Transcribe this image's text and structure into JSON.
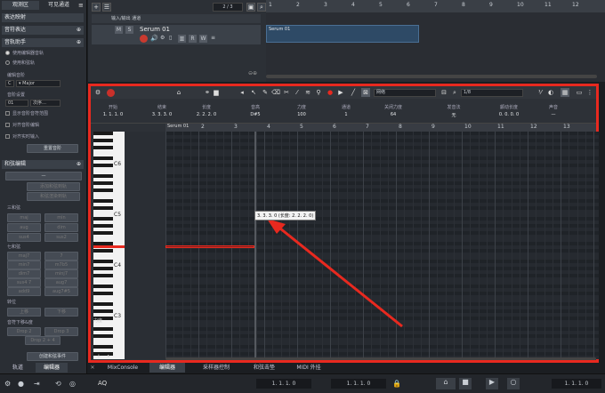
{
  "left_panel": {
    "tabs": [
      "观测区",
      "可见通道"
    ],
    "sections": {
      "expression_map": "表达映射",
      "note_expression": "音符表达",
      "chord_assistant": "音轨助手",
      "chord_editing": "和弦编辑"
    },
    "chord_assistant": {
      "radio_editor": "使用编辑器音轨",
      "radio_project": "使用和弦轨",
      "editor_key_label": "编辑音阶",
      "key_root": "C",
      "key_mode": "Major",
      "chord_snap_label": "音阶设置",
      "snap_value": "01",
      "snap_mode": "次序…",
      "check_show": "显示音阶音符范围",
      "check_edit": "对齐音阶编辑",
      "check_input": "对齐实时输入",
      "reset_button": "重置音阶"
    },
    "chord_editing": {
      "dash_button": "—",
      "add_button": "添加和弦到轨",
      "use_button": "和弦渲染到轨",
      "triads_label": "三和弦",
      "triads": [
        [
          "maj",
          "min"
        ],
        [
          "aug",
          "dim"
        ],
        [
          "sus4",
          "sus2"
        ]
      ],
      "sevenths_label": "七和弦",
      "sevenths": [
        [
          "maj7",
          "7"
        ],
        [
          "min7",
          "m7b5"
        ],
        [
          "dim7",
          "minj7"
        ],
        [
          "sus4 7",
          "aug7"
        ],
        [
          "add9",
          "aug7#5"
        ]
      ],
      "inversion_label": "转位",
      "inversions": [
        "上移",
        "下移"
      ],
      "drop_label": "音符下移&度",
      "drops": [
        "Drop 2",
        "Drop 3",
        "Drop 2 + 4"
      ],
      "create_button": "创建和弦事件"
    },
    "bottom_tabs": [
      "轨道",
      "编辑器"
    ]
  },
  "project": {
    "toolbar_counter": "2 / 3",
    "folder_title": "输入/输出 通道",
    "track_name": "Serum 01",
    "track_buttons": [
      "M",
      "S",
      "R",
      "W"
    ]
  },
  "arranger": {
    "ruler": [
      "1",
      "2",
      "3",
      "4",
      "5",
      "6",
      "7",
      "8",
      "9",
      "10",
      "11",
      "12"
    ],
    "part_name": "Serum 01"
  },
  "editor": {
    "toolbar": {
      "quantize_label": "网络",
      "quantize_value": "1/8"
    },
    "info": {
      "labels": [
        "开始",
        "结束",
        "长度",
        "音高",
        "力度",
        "通道",
        "关闭力度",
        "发音法",
        "颤动长度",
        "声音"
      ],
      "values": [
        "1. 1. 1. 0",
        "3. 3. 3. 0",
        "2. 2. 2. 0",
        "D#5",
        "100",
        "1",
        "64",
        "无",
        "0. 0. 0. 0",
        "—"
      ]
    },
    "ruler": [
      "2",
      "3",
      "4",
      "5",
      "6",
      "7",
      "8",
      "9",
      "10",
      "11",
      "12",
      "13"
    ],
    "part_label": "Serum 01",
    "octaves": [
      "C6",
      "C5",
      "C4",
      "C3"
    ],
    "tooltip": "3. 3. 3. 0 (长度: 2. 2. 2. 0)",
    "velocity_lane": "力度",
    "accent_color": "#e8291f"
  },
  "bottom_zone_tabs": [
    "MixConsole",
    "编辑器",
    "采样器控制",
    "和弦击垫",
    "MIDI 外挂"
  ],
  "transport": {
    "aq": "AQ",
    "positions": [
      "1. 1. 1. 0",
      "1. 1. 1. 0",
      "1. 1. 1. 0"
    ]
  }
}
